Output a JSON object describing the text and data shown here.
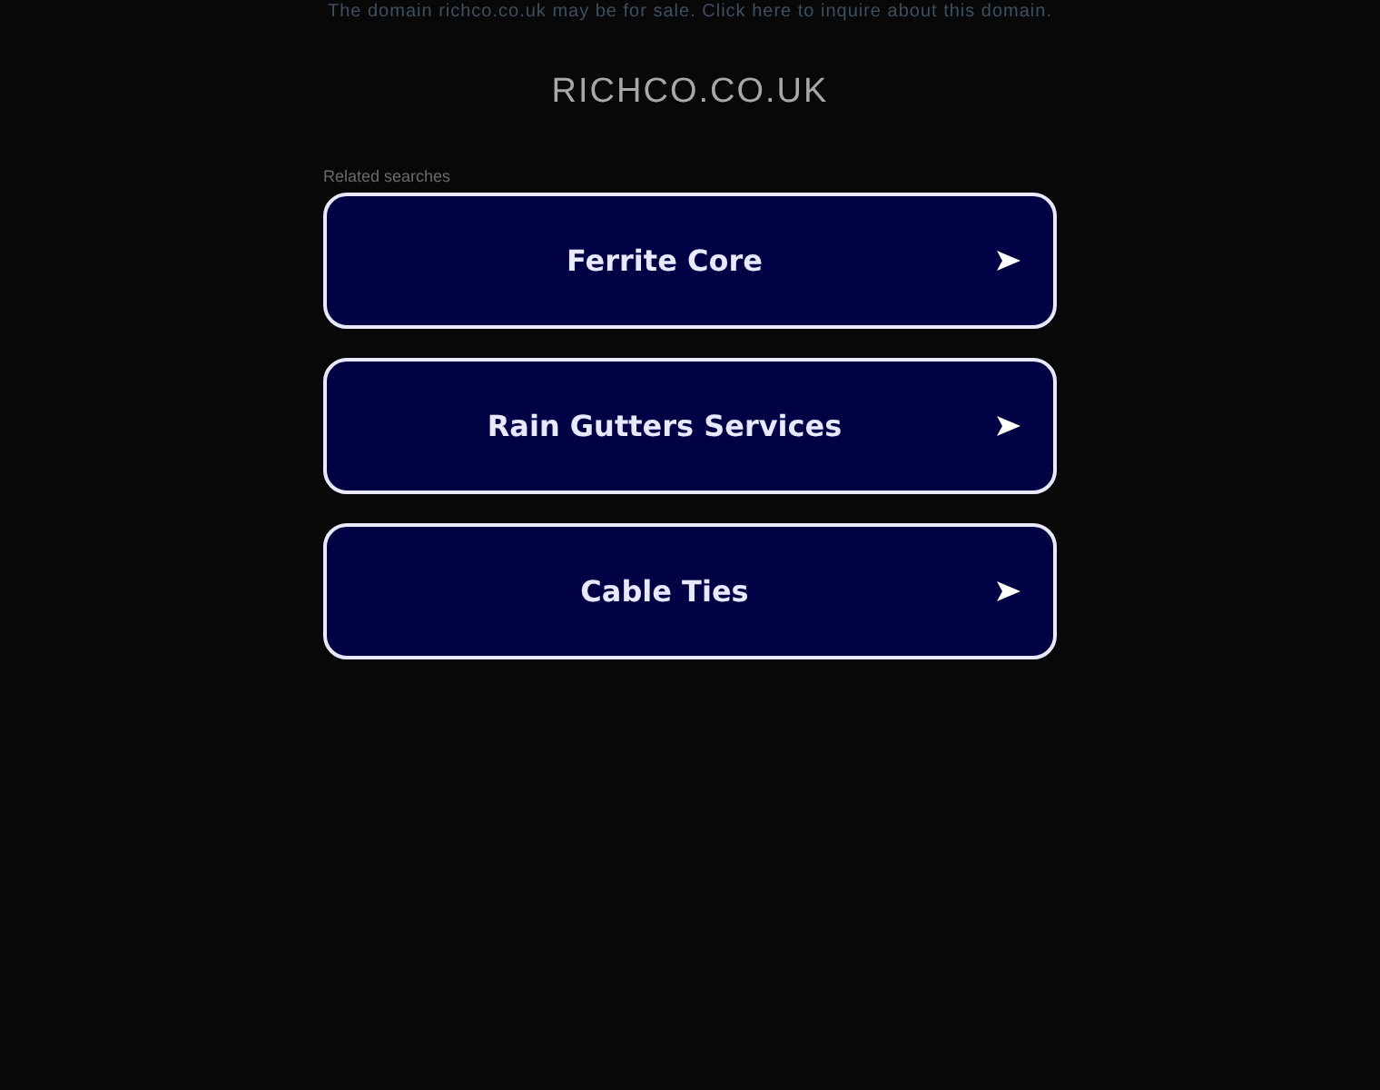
{
  "sale_notice": "The domain richco.co.uk may be for sale. Click here to inquire about this domain.",
  "domain_title": "RICHCO.CO.UK",
  "related_label": "Related searches",
  "links": [
    {
      "label": "Ferrite Core"
    },
    {
      "label": "Rain Gutters Services"
    },
    {
      "label": "Cable Ties"
    }
  ]
}
